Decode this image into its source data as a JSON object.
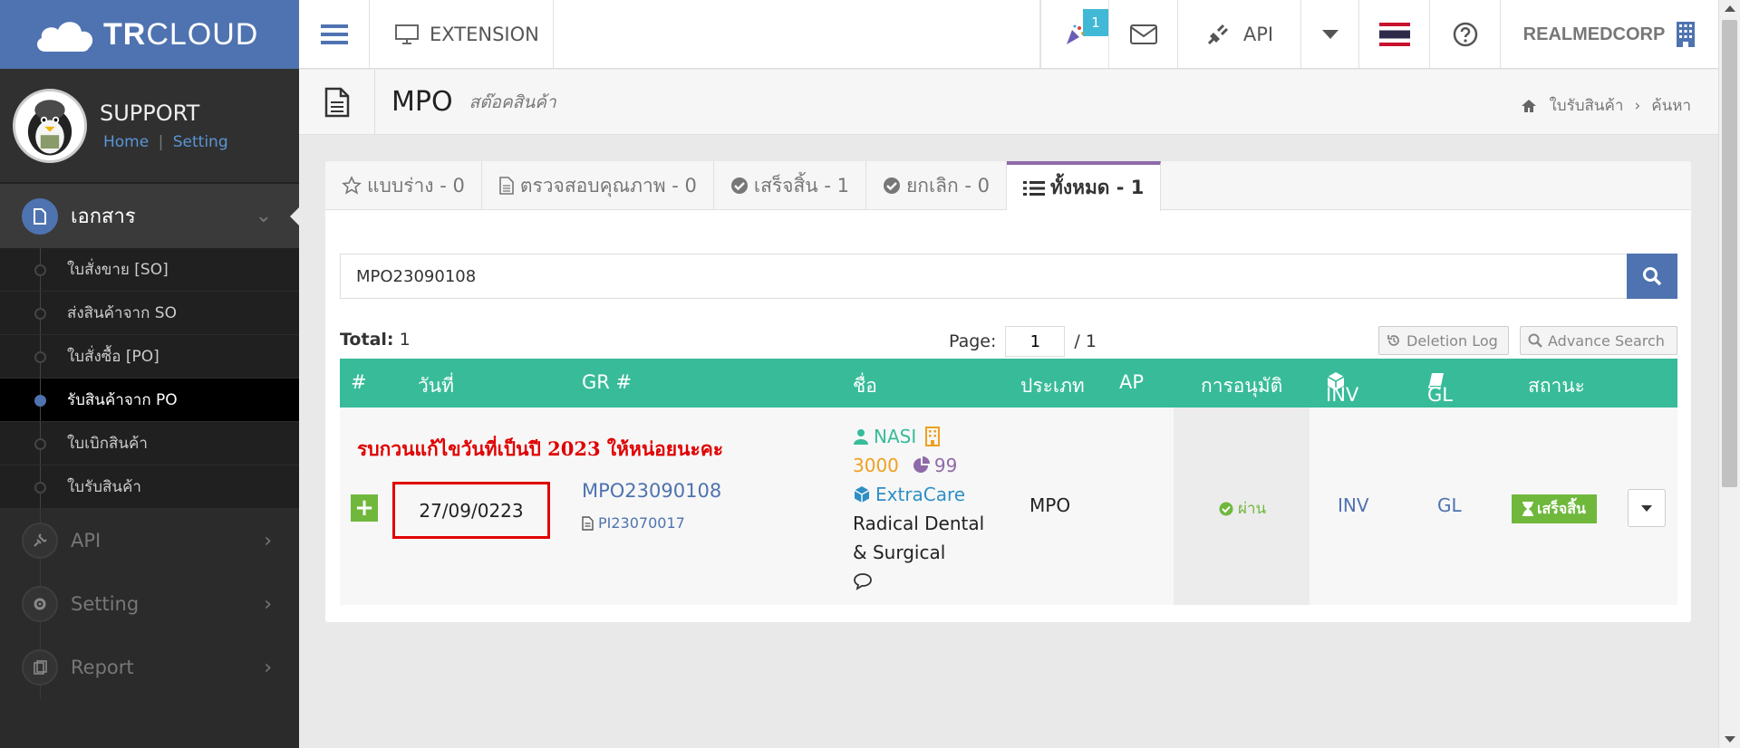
{
  "brand": {
    "bold": "TR",
    "light": "CLOUD"
  },
  "user": {
    "name": "SUPPORT",
    "home_link": "Home",
    "separator": "|",
    "setting_link": "Setting"
  },
  "sidebar": {
    "documents": {
      "label": "เอกสาร",
      "icon": "document-icon"
    },
    "sub_items": [
      {
        "label": "ใบสั่งขาย [SO]"
      },
      {
        "label": "ส่งสินค้าจาก SO"
      },
      {
        "label": "ใบสั่งซื้อ [PO]"
      },
      {
        "label": "รับสินค้าจาก PO"
      },
      {
        "label": "ใบเบิกสินค้า"
      },
      {
        "label": "ใบรับสินค้า"
      }
    ],
    "active_sub": "รับสินค้าจาก PO",
    "menus": [
      {
        "label": "API",
        "icon": "plug-icon"
      },
      {
        "label": "Setting",
        "icon": "gear-icon"
      },
      {
        "label": "Report",
        "icon": "report-icon"
      }
    ]
  },
  "topbar": {
    "extension_label": "EXTENSION",
    "notification_count": "1",
    "api_label": "API",
    "company": "REALMEDCORP"
  },
  "page": {
    "title": "MPO",
    "subtitle": "สต๊อคสินค้า",
    "breadcrumb": [
      "ใบรับสินค้า",
      "ค้นหา"
    ]
  },
  "tabs": [
    {
      "label": "แบบร่าง - 0",
      "icon": "star-icon"
    },
    {
      "label": "ตรวจสอบคุณภาพ - 0",
      "icon": "file-icon"
    },
    {
      "label": "เสร็จสิ้น - 1",
      "icon": "check-circle-icon"
    },
    {
      "label": "ยกเลิก - 0",
      "icon": "check-circle-icon"
    },
    {
      "label": "ทั้งหมด - 1",
      "icon": "list-icon"
    }
  ],
  "search": {
    "value": "MPO23090108"
  },
  "listing": {
    "total_label": "Total:",
    "total_value": "1",
    "page_label": "Page:",
    "page_value": "1",
    "page_total": "/ 1",
    "deletion_log": "Deletion Log",
    "advance_search": "Advance Search"
  },
  "table": {
    "headers": {
      "num": "#",
      "date": "วันที่",
      "gr": "GR #",
      "name": "ชื่อ",
      "type": "ประเภท",
      "ap": "AP",
      "approval": "การอนุมัติ",
      "inv": "INV",
      "gl": "GL",
      "status": "สถานะ"
    },
    "row": {
      "note": "รบกวนแก้ไขวันที่เป็นปี 2023 ให้หน่อยนะคะ",
      "date": "27/09/0223",
      "gr_number": "MPO23090108",
      "pi_number": "PI23070017",
      "supplier_code": "NASI",
      "amount": "3000",
      "count": "99",
      "brand": "ExtraCare",
      "supplier_name": "Radical Dental & Surgical",
      "type": "MPO",
      "approval": "ผ่าน",
      "inv": "INV",
      "gl": "GL",
      "status": "เสร็จสิ้น"
    }
  },
  "colors": {
    "primary": "#4f73b0",
    "table_header": "#38bb99",
    "success": "#6fb83c",
    "alert": "#e00000",
    "tab_accent": "#8f6aa8"
  }
}
